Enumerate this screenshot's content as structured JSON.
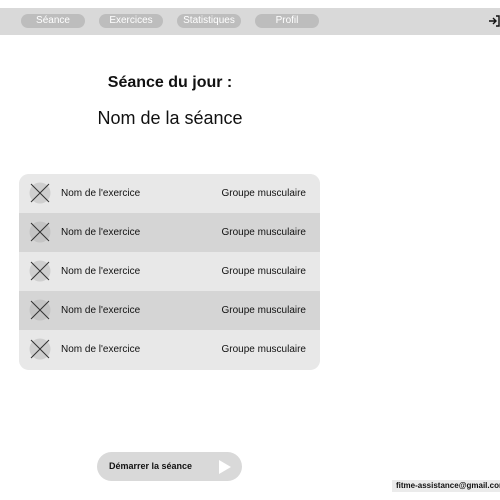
{
  "nav": {
    "tabs": [
      "Séance",
      "Exercices",
      "Statistiques",
      "Profil"
    ]
  },
  "header": {
    "title": "Séance du jour :",
    "session_name": "Nom de la séance"
  },
  "exercises": [
    {
      "name": "Nom de l'exercice",
      "group": "Groupe musculaire"
    },
    {
      "name": "Nom de l'exercice",
      "group": "Groupe musculaire"
    },
    {
      "name": "Nom de l'exercice",
      "group": "Groupe musculaire"
    },
    {
      "name": "Nom de l'exercice",
      "group": "Groupe musculaire"
    },
    {
      "name": "Nom de l'exercice",
      "group": "Groupe musculaire"
    }
  ],
  "actions": {
    "start_label": "Démarrer la séance"
  },
  "footer": {
    "email": "fitme-assistance@gmail.com"
  },
  "icons": {
    "logout": "logout-icon",
    "placeholder": "image-placeholder-icon",
    "play": "play-icon"
  },
  "colors": {
    "topbar": "#d9d9d9",
    "tab": "#bdbdbd",
    "row_light": "#e8e8e8",
    "row_dark": "#d5d5d5",
    "button": "#d9d9d9"
  }
}
